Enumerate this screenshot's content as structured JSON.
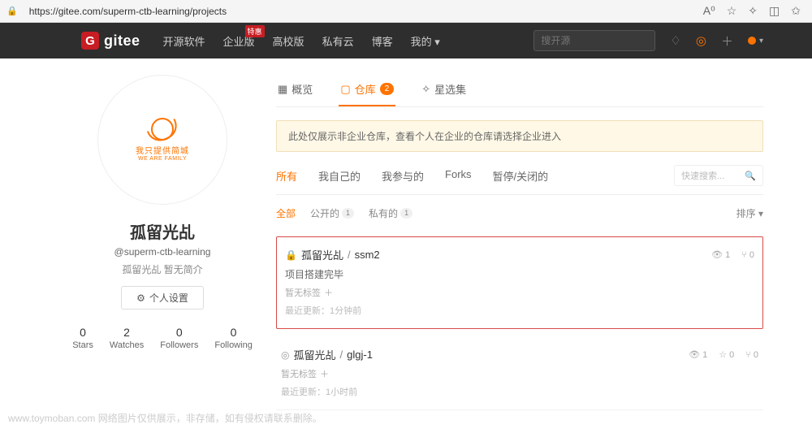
{
  "browser": {
    "url": "https://gitee.com/superm-ctb-learning/projects",
    "zoom": "A⁰"
  },
  "nav": {
    "logo_letter": "G",
    "logo_text": "gitee",
    "items": [
      "开源软件",
      "企业版",
      "高校版",
      "私有云",
      "博客",
      "我的"
    ],
    "hot_badge": "特惠",
    "search_placeholder": "搜开源"
  },
  "profile": {
    "avatar_cn": "我只提供简城",
    "avatar_en": "WE ARE FAMILY",
    "username": "孤留光乩",
    "handle": "@superm-ctb-learning",
    "bio": "孤留光乩 暂无简介",
    "settings_label": "个人设置",
    "stats": [
      {
        "num": "0",
        "label": "Stars"
      },
      {
        "num": "2",
        "label": "Watches"
      },
      {
        "num": "0",
        "label": "Followers"
      },
      {
        "num": "0",
        "label": "Following"
      }
    ]
  },
  "tabs": [
    {
      "label": "概览",
      "badge": null
    },
    {
      "label": "仓库",
      "badge": "2"
    },
    {
      "label": "星选集",
      "badge": null
    }
  ],
  "notice": "此处仅展示非企业仓库，查看个人在企业的仓库请选择企业进入",
  "subtabs": [
    "所有",
    "我自己的",
    "我参与的",
    "Forks",
    "暂停/关闭的"
  ],
  "quick_search_placeholder": "快速搜索...",
  "filters": [
    {
      "label": "全部",
      "count": null
    },
    {
      "label": "公开的",
      "count": "1"
    },
    {
      "label": "私有的",
      "count": "1"
    }
  ],
  "sort_label": "排序",
  "repos": [
    {
      "owner": "孤留光乩",
      "name": "ssm2",
      "private": true,
      "desc": "项目搭建完毕",
      "tags_label": "暂无标签",
      "update_label": "最近更新：",
      "update_time": "1分钟前",
      "watch": "1",
      "star": null,
      "fork": "0",
      "highlighted": true
    },
    {
      "owner": "孤留光乩",
      "name": "glgj-1",
      "private": false,
      "desc": null,
      "tags_label": "暂无标签",
      "update_label": "最近更新：",
      "update_time": "1小时前",
      "watch": "1",
      "star": "0",
      "fork": "0",
      "highlighted": false
    }
  ],
  "watermark": "www.toymoban.com 网络图片仅供展示，非存储，如有侵权请联系删除。"
}
